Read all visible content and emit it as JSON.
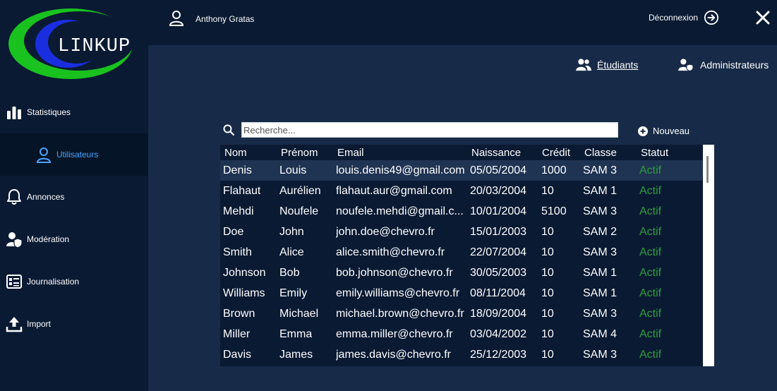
{
  "app": {
    "logo_text": "LINKUP"
  },
  "sidebar": {
    "items": [
      {
        "label": "Statistiques",
        "icon": "bar-chart-icon",
        "active": false
      },
      {
        "label": "Utilisateurs",
        "icon": "user-icon",
        "active": true
      },
      {
        "label": "Annonces",
        "icon": "bell-icon",
        "active": false
      },
      {
        "label": "Modération",
        "icon": "user-shield-icon",
        "active": false
      },
      {
        "label": "Journalisation",
        "icon": "log-icon",
        "active": false
      },
      {
        "label": "Import",
        "icon": "upload-icon",
        "active": false
      }
    ]
  },
  "header": {
    "user_name": "Anthony Gratas",
    "logout_label": "Déconnexion"
  },
  "tabs": {
    "students": "Étudiants",
    "admins": "Administrateurs"
  },
  "search": {
    "placeholder": "Recherche...",
    "value": ""
  },
  "actions": {
    "new_label": "Nouveau"
  },
  "table": {
    "columns": [
      "Nom",
      "Prénom",
      "Email",
      "Naissance",
      "Crédit",
      "Classe",
      "Statut"
    ],
    "rows": [
      [
        "Denis",
        "Louis",
        "louis.denis49@gmail.com",
        "05/05/2004",
        "1000",
        "SAM 3",
        "Actif"
      ],
      [
        "Flahaut",
        "Aurélien",
        "flahaut.aur@gmail.com",
        "20/03/2004",
        "10",
        "SAM 1",
        "Actif"
      ],
      [
        "Mehdi",
        "Noufele",
        "noufele.mehdi@gmail.c...",
        "10/01/2004",
        "5100",
        "SAM 3",
        "Actif"
      ],
      [
        "Doe",
        "John",
        "john.doe@chevro.fr",
        "15/01/2003",
        "10",
        "SAM 2",
        "Actif"
      ],
      [
        "Smith",
        "Alice",
        "alice.smith@chevro.fr",
        "22/07/2004",
        "10",
        "SAM 3",
        "Actif"
      ],
      [
        "Johnson",
        "Bob",
        "bob.johnson@chevro.fr",
        "30/05/2003",
        "10",
        "SAM 1",
        "Actif"
      ],
      [
        "Williams",
        "Emily",
        "emily.williams@chevro.fr",
        "08/11/2004",
        "10",
        "SAM 1",
        "Actif"
      ],
      [
        "Brown",
        "Michael",
        "michael.brown@chevro.fr",
        "18/09/2004",
        "10",
        "SAM 3",
        "Actif"
      ],
      [
        "Miller",
        "Emma",
        "emma.miller@chevro.fr",
        "03/04/2002",
        "10",
        "SAM 4",
        "Actif"
      ],
      [
        "Davis",
        "James",
        "james.davis@chevro.fr",
        "25/12/2003",
        "10",
        "SAM 3",
        "Actif"
      ]
    ],
    "selected_row": 0
  },
  "colors": {
    "sidebar_bg": "#0a1a33",
    "main_bg": "#172a47",
    "active_text": "#4aa3ff",
    "status_active": "#2e9e3e",
    "logo_green": "#19c21e",
    "logo_blue": "#1a2ee0"
  }
}
